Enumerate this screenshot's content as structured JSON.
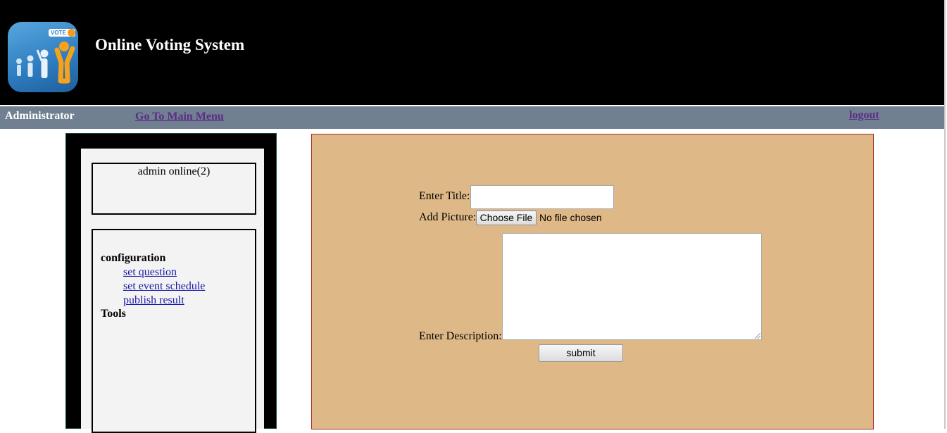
{
  "header": {
    "logo_icon": "vote-people-logo-icon",
    "logo_tag": "VOTE",
    "title": "Online Voting System"
  },
  "navbar": {
    "role": "Administrator",
    "main_menu_link": "Go To Main Menu",
    "logout_link": "logout"
  },
  "sidebar": {
    "online_status": "admin online(2)",
    "sections": [
      {
        "heading": "configuration",
        "links": [
          "set question",
          "set event schedule",
          "publish result"
        ]
      },
      {
        "heading": "Tools",
        "links": []
      }
    ]
  },
  "form": {
    "title_label": "Enter Title:",
    "title_value": "",
    "picture_label": "Add Picture:",
    "choose_file_label": "Choose File",
    "file_status": "No file chosen",
    "description_label": "Enter Description:",
    "description_value": "",
    "submit_label": "submit"
  },
  "colors": {
    "header_bg": "#000000",
    "navbar_bg": "#708090",
    "link_visited": "#5b2c86",
    "panel_bg": "#deb887",
    "panel_border": "#a52a2a",
    "sidebar_bg": "#000000",
    "sidebar_inner_bg": "#f3f3f3",
    "sidebar_link": "#1a1aa6"
  }
}
